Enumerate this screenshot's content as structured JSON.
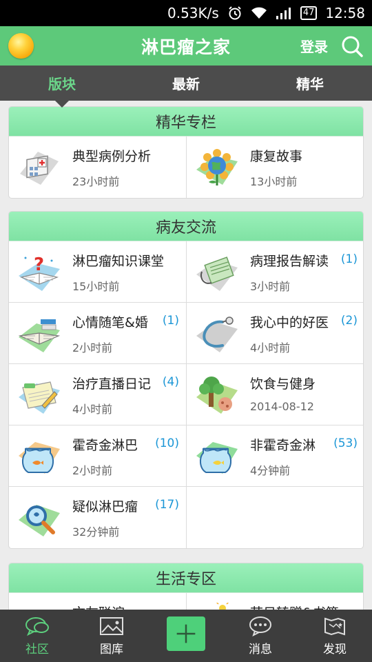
{
  "status_bar": {
    "speed": "0.53K/s",
    "battery": "47",
    "time": "12:58"
  },
  "header": {
    "title": "淋巴瘤之家",
    "login_label": "登录"
  },
  "tabs": [
    {
      "label": "版块",
      "active": true
    },
    {
      "label": "最新",
      "active": false
    },
    {
      "label": "精华",
      "active": false
    }
  ],
  "sections": [
    {
      "title": "精华专栏",
      "items": [
        {
          "name": "典型病例分析",
          "time": "23小时前",
          "count": "",
          "icon": "hospital-icon"
        },
        {
          "name": "康复故事",
          "time": "13小时前",
          "count": "",
          "icon": "earth-flower-icon"
        }
      ]
    },
    {
      "title": "病友交流",
      "items": [
        {
          "name": "淋巴瘤知识课堂",
          "time": "15小时前",
          "count": "",
          "icon": "question-book-icon"
        },
        {
          "name": "病理报告解读",
          "time": "3小时前",
          "count": "(1)",
          "icon": "report-icon"
        },
        {
          "name": "心情随笔&婚",
          "time": "2小时前",
          "count": "(1)",
          "icon": "open-book-icon"
        },
        {
          "name": "我心中的好医",
          "time": "4小时前",
          "count": "(2)",
          "icon": "stethoscope-icon"
        },
        {
          "name": "治疗直播日记",
          "time": "4小时前",
          "count": "(4)",
          "icon": "diary-icon"
        },
        {
          "name": "饮食与健身",
          "time": "2014-08-12",
          "count": "",
          "icon": "tree-icon"
        },
        {
          "name": "霍奇金淋巴",
          "time": "2小时前",
          "count": "(10)",
          "icon": "fishbowl-icon"
        },
        {
          "name": "非霍奇金淋",
          "time": "4分钟前",
          "count": "(53)",
          "icon": "fishbowl-icon"
        },
        {
          "name": "疑似淋巴瘤",
          "time": "32分钟前",
          "count": "(17)",
          "icon": "magnifier-icon"
        }
      ]
    },
    {
      "title": "生活专区",
      "items": [
        {
          "name": "文友联谊",
          "time": "",
          "count": "",
          "icon": "people-icon"
        },
        {
          "name": "节日转赠&书签",
          "time": "",
          "count": "",
          "icon": "bulb-icon"
        }
      ]
    }
  ],
  "bottom_nav": [
    {
      "label": "社区",
      "icon": "community-icon",
      "active": true
    },
    {
      "label": "图库",
      "icon": "gallery-icon",
      "active": false
    },
    {
      "label": "",
      "icon": "add-icon",
      "active": false
    },
    {
      "label": "消息",
      "icon": "message-icon",
      "active": false
    },
    {
      "label": "发现",
      "icon": "discover-icon",
      "active": false
    }
  ],
  "colors": {
    "accent": "#5dc97a",
    "section_header": "#8ee7ae",
    "count": "#1b96d6",
    "tab_bar": "#4c4c4c",
    "nav_bar": "#3d3d3d"
  }
}
